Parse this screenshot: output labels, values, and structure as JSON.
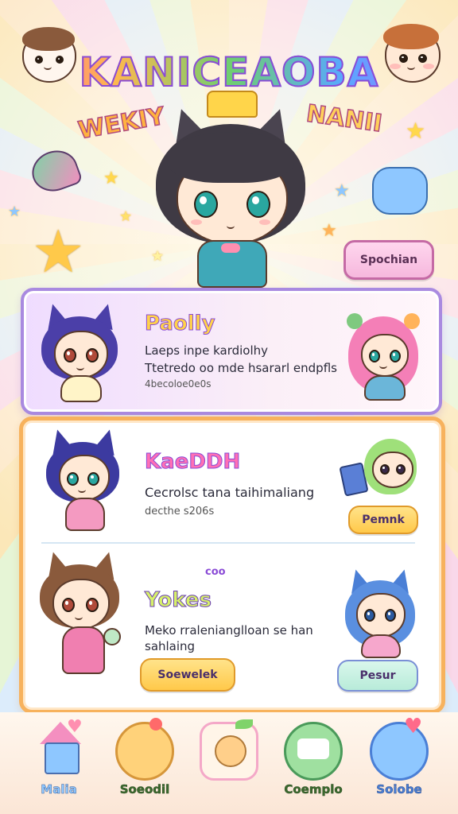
{
  "header": {
    "title": "KANICEAOBA",
    "subtitle_left": "WEKIY",
    "subtitle_right": "NANII"
  },
  "side_button": {
    "label": "Spochian"
  },
  "card_top": {
    "heading": "Paolly",
    "line1": "Laeps inpe kardiolhy",
    "line2": "Ttetredo oo mde hsararl endpfls",
    "line3": "4becoloe0e0s"
  },
  "card_bottom": {
    "entry1": {
      "heading": "KaeDDH",
      "line1": "Cecrolsc tana taihimaliang",
      "line2": "decthe s206s",
      "button": "Pemnk"
    },
    "entry2": {
      "badge": "coo",
      "heading": "Yokes",
      "line1": "Meko rralenianglloan se han",
      "line2": "sahlaing",
      "button": "Soewelek",
      "button_right": "Pesur"
    }
  },
  "nav": {
    "items": [
      {
        "label": "Malia",
        "icon": "home-icon"
      },
      {
        "label": "Soeodil",
        "icon": "bread-icon"
      },
      {
        "label": "",
        "icon": "profile-avatar-icon"
      },
      {
        "label": "Coemplo",
        "icon": "chat-icon"
      },
      {
        "label": "Soiobe",
        "icon": "heart-bubble-icon"
      }
    ]
  },
  "colors": {
    "card_top_border": "#a98ae0",
    "card_bottom_border": "#f7b25d",
    "button_yellow": "#ffd45e",
    "button_teal": "#c6f0df"
  }
}
